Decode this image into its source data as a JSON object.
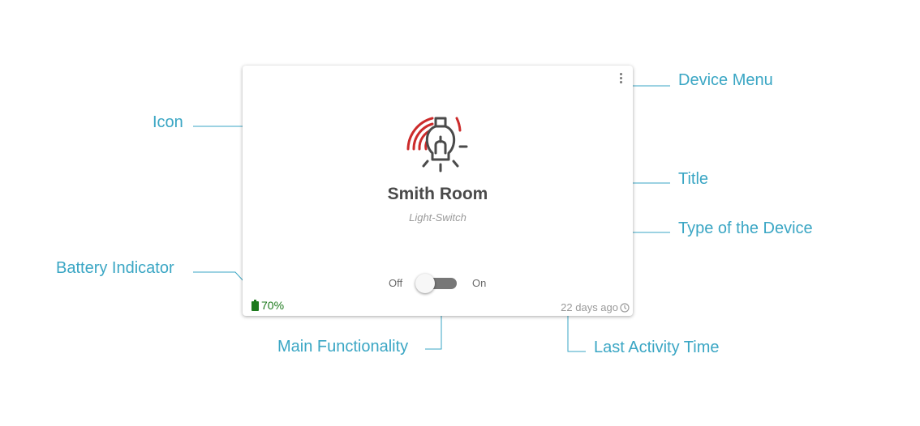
{
  "card": {
    "title": "Smith Room",
    "type": "Light-Switch",
    "toggle": {
      "off_label": "Off",
      "on_label": "On",
      "state": "off"
    },
    "battery": "70%",
    "last_activity": "22 days ago"
  },
  "annotations": {
    "device_menu": "Device Menu",
    "icon": "Icon",
    "title": "Title",
    "type": "Type of the Device",
    "battery": "Battery Indicator",
    "main_functionality": "Main Functionality",
    "last_activity": "Last Activity Time"
  },
  "colors": {
    "annotation": "#3aa6c4",
    "icon_accent": "#cc2b2b",
    "icon_base": "#4a4a4a",
    "battery": "#1d7a1d"
  },
  "icons": [
    "kebab-menu-icon",
    "light-bulb-icon",
    "battery-icon",
    "clock-icon"
  ]
}
